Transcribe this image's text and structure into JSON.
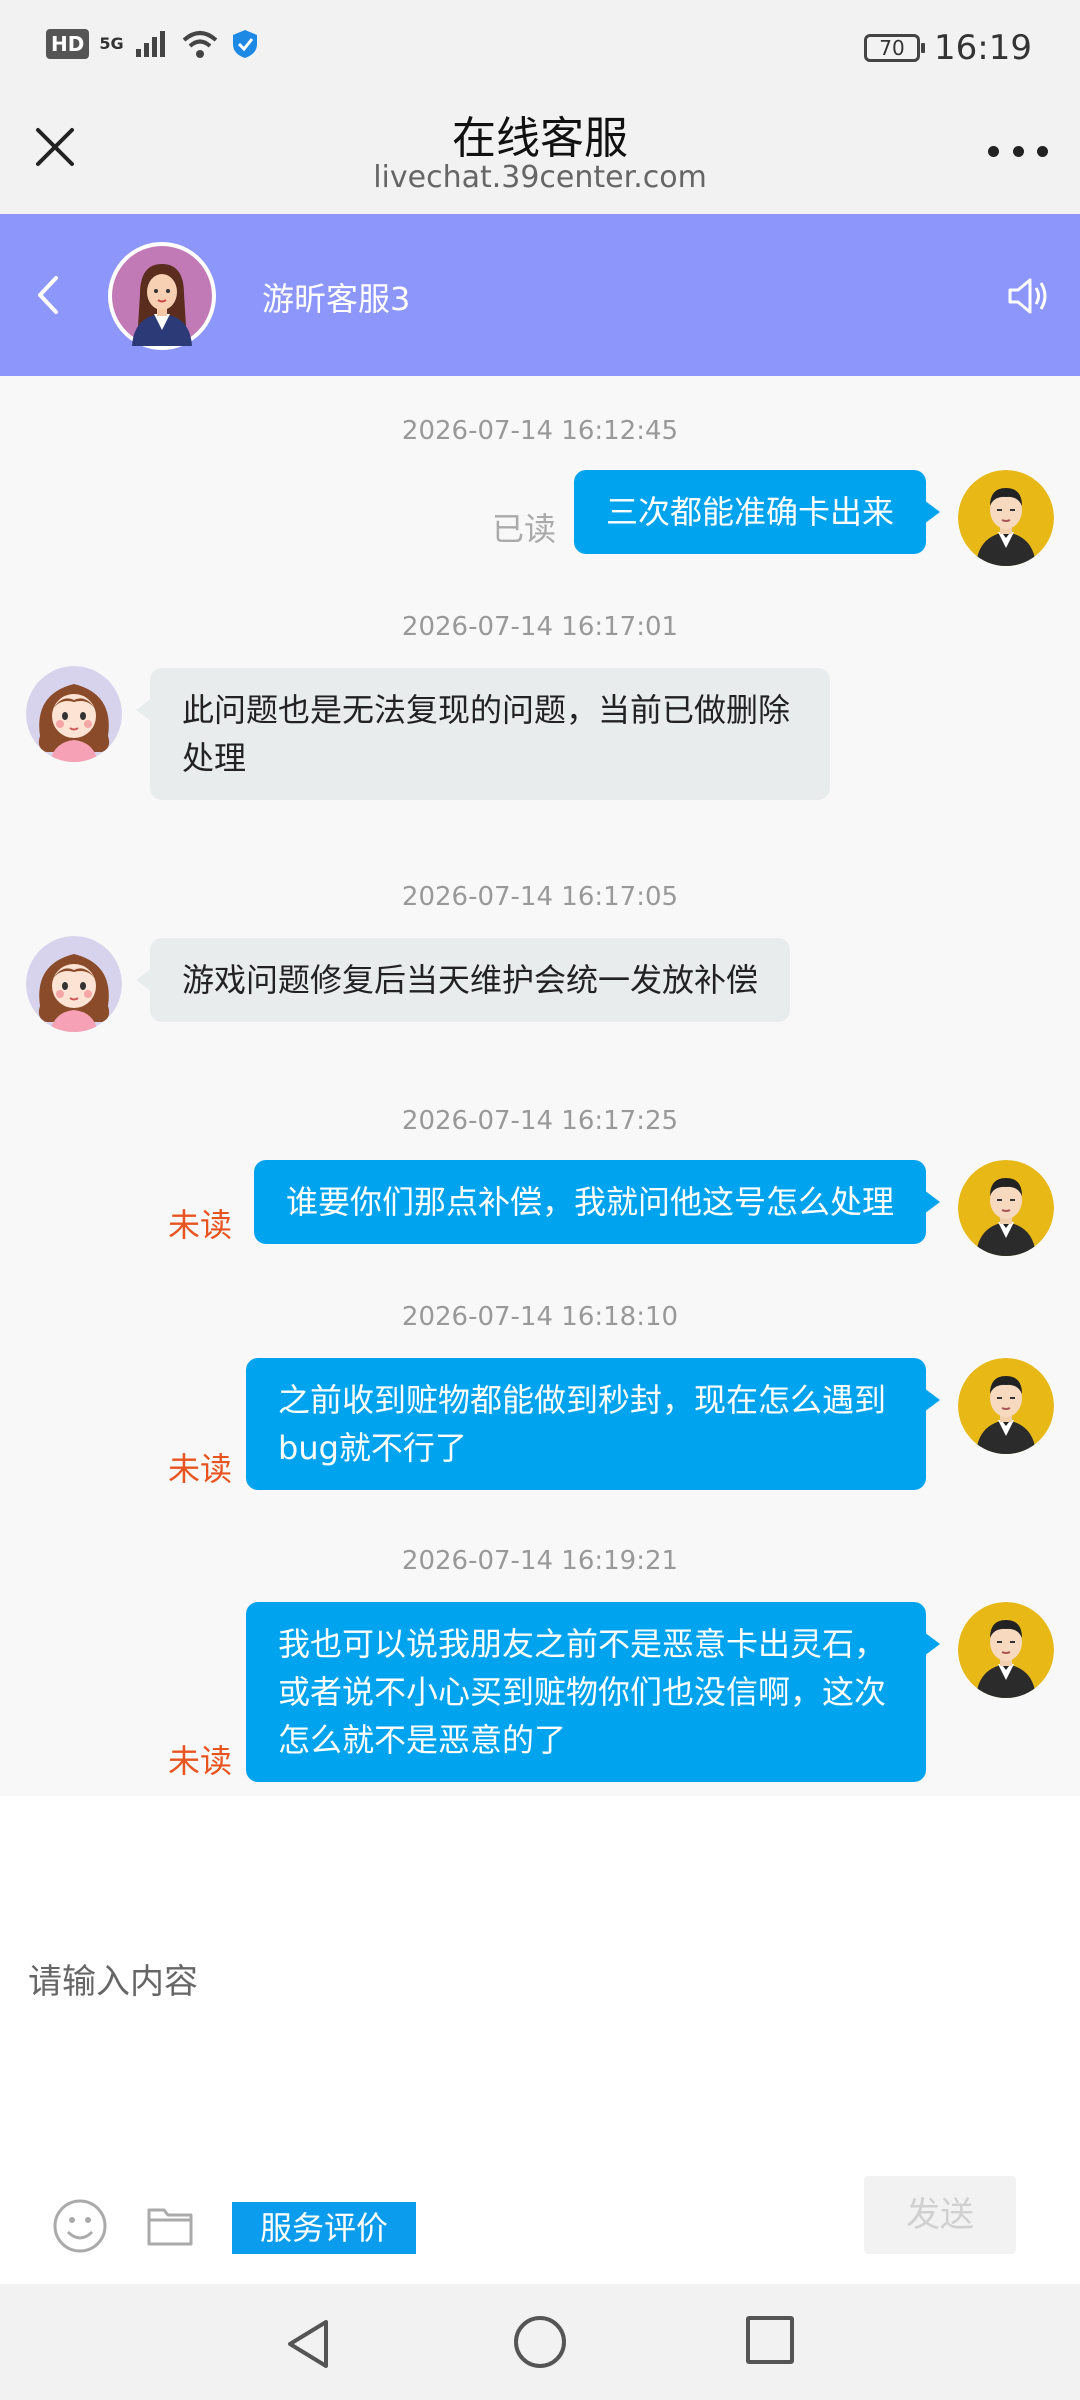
{
  "status_bar": {
    "hd": "HD",
    "network": "5G",
    "battery": "70",
    "time": "16:19"
  },
  "titlebar": {
    "title": "在线客服",
    "url": "livechat.39center.com"
  },
  "chat_header": {
    "agent_name": "游昕客服3"
  },
  "messages": [
    {
      "timestamp": "2026-07-14 16:12:45",
      "from": "user",
      "text": "三次都能准确卡出来",
      "status": "已读"
    },
    {
      "timestamp": "2026-07-14 16:17:01",
      "from": "agent",
      "text": "此问题也是无法复现的问题，当前已做删除处理"
    },
    {
      "timestamp": "2026-07-14 16:17:05",
      "from": "agent",
      "text": "游戏问题修复后当天维护会统一发放补偿"
    },
    {
      "timestamp": "2026-07-14 16:17:25",
      "from": "user",
      "text": "谁要你们那点补偿，我就问他这号怎么处理",
      "status": "未读"
    },
    {
      "timestamp": "2026-07-14 16:18:10",
      "from": "user",
      "text": "之前收到赃物都能做到秒封，现在怎么遇到bug就不行了",
      "status": "未读"
    },
    {
      "timestamp": "2026-07-14 16:19:21",
      "from": "user",
      "text": "我也可以说我朋友之前不是恶意卡出灵石，或者说不小心买到赃物你们也没信啊，这次怎么就不是恶意的了",
      "status": "未读"
    }
  ],
  "input": {
    "placeholder": "请输入内容",
    "value": "",
    "rate_label": "服务评价",
    "send_label": "发送"
  },
  "colors": {
    "header_bg": "#8c96fb",
    "user_bubble": "#00a3ee",
    "agent_bubble": "#e9eced",
    "unread": "#e8541f",
    "rate_button": "#0b9cee"
  }
}
